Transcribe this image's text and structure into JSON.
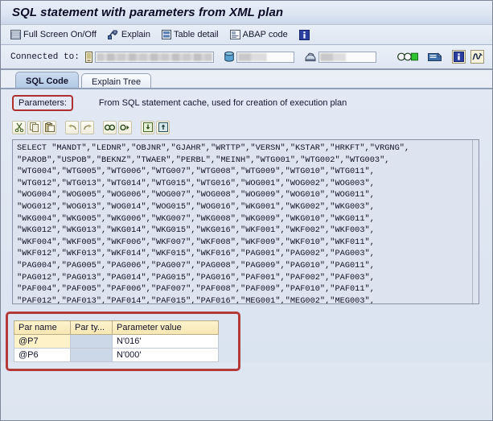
{
  "window": {
    "title": "SQL statement with parameters from XML plan"
  },
  "function_toolbar": {
    "items": [
      {
        "label": "Full Screen On/Off",
        "icon": "fullscreen-icon"
      },
      {
        "label": "Explain",
        "icon": "explain-icon"
      },
      {
        "label": "Table detail",
        "icon": "table-detail-icon"
      },
      {
        "label": "ABAP code",
        "icon": "abap-code-icon"
      },
      {
        "label": "",
        "icon": "info-icon"
      }
    ]
  },
  "connection_bar": {
    "label": "Connected to:",
    "system_icon": "system-icon",
    "system_value": "",
    "database_icon": "database-icon",
    "database_value": "",
    "client_icon": "client-icon",
    "client_value": "",
    "status_icon": "traffic-light-green-icon",
    "note_icon": "note-icon",
    "info_icon": "info-icon",
    "signature_icon": "signature-icon"
  },
  "tabs": [
    {
      "label": "SQL Code",
      "active": true
    },
    {
      "label": "Explain Tree",
      "active": false
    }
  ],
  "parameters_section": {
    "label": "Parameters:",
    "description": "From SQL statement cache, used for creation of execution plan",
    "highlight_color": "#b03030"
  },
  "editor_toolbar": {
    "buttons": [
      {
        "icon": "cut-icon"
      },
      {
        "icon": "copy-icon"
      },
      {
        "icon": "paste-icon"
      },
      {
        "icon": "undo-icon"
      },
      {
        "icon": "redo-icon"
      },
      {
        "icon": "find-icon"
      },
      {
        "icon": "find-next-icon"
      },
      {
        "icon": "import-icon"
      },
      {
        "icon": "export-icon"
      }
    ]
  },
  "sql_code": {
    "lines": [
      "SELECT \"MANDT\",\"LEDNR\",\"OBJNR\",\"GJAHR\",\"WRTTP\",\"VERSN\",\"KSTAR\",\"HRKFT\",\"VRGNG\",",
      "\"PAROB\",\"USPOB\",\"BEKNZ\",\"TWAER\",\"PERBL\",\"MEINH\",\"WTG001\",\"WTG002\",\"WTG003\",",
      "\"WTG004\",\"WTG005\",\"WTG006\",\"WTG007\",\"WTG008\",\"WTG009\",\"WTG010\",\"WTG011\",",
      "\"WTG012\",\"WTG013\",\"WTG014\",\"WTG015\",\"WTG016\",\"WOG001\",\"WOG002\",\"WOG003\",",
      "\"WOG004\",\"WOG005\",\"WOG006\",\"WOG007\",\"WOG008\",\"WOG009\",\"WOG010\",\"WOG011\",",
      "\"WOG012\",\"WOG013\",\"WOG014\",\"WOG015\",\"WOG016\",\"WKG001\",\"WKG002\",\"WKG003\",",
      "\"WKG004\",\"WKG005\",\"WKG006\",\"WKG007\",\"WKG008\",\"WKG009\",\"WKG010\",\"WKG011\",",
      "\"WKG012\",\"WKG013\",\"WKG014\",\"WKG015\",\"WKG016\",\"WKF001\",\"WKF002\",\"WKF003\",",
      "\"WKF004\",\"WKF005\",\"WKF006\",\"WKF007\",\"WKF008\",\"WKF009\",\"WKF010\",\"WKF011\",",
      "\"WKF012\",\"WKF013\",\"WKF014\",\"WKF015\",\"WKF016\",\"PAG001\",\"PAG002\",\"PAG003\",",
      "\"PAG004\",\"PAG005\",\"PAG006\",\"PAG007\",\"PAG008\",\"PAG009\",\"PAG010\",\"PAG011\",",
      "\"PAG012\",\"PAG013\",\"PAG014\",\"PAG015\",\"PAG016\",\"PAF001\",\"PAF002\",\"PAF003\",",
      "\"PAF004\",\"PAF005\",\"PAF006\",\"PAF007\",\"PAF008\",\"PAF009\",\"PAF010\",\"PAF011\",",
      "\"PAF012\",\"PAF013\",\"PAF014\",\"PAF015\",\"PAF016\",\"MEG001\",\"MEG002\",\"MEG003\","
    ]
  },
  "parameter_table": {
    "columns": [
      "Par name",
      "Par ty...",
      "Parameter value"
    ],
    "rows": [
      {
        "name": "@P7",
        "type": "",
        "value": "N'016'",
        "selected": true
      },
      {
        "name": "@P6",
        "type": "",
        "value": "N'000'",
        "selected": false
      }
    ],
    "highlight_color": "#b43a3a"
  }
}
